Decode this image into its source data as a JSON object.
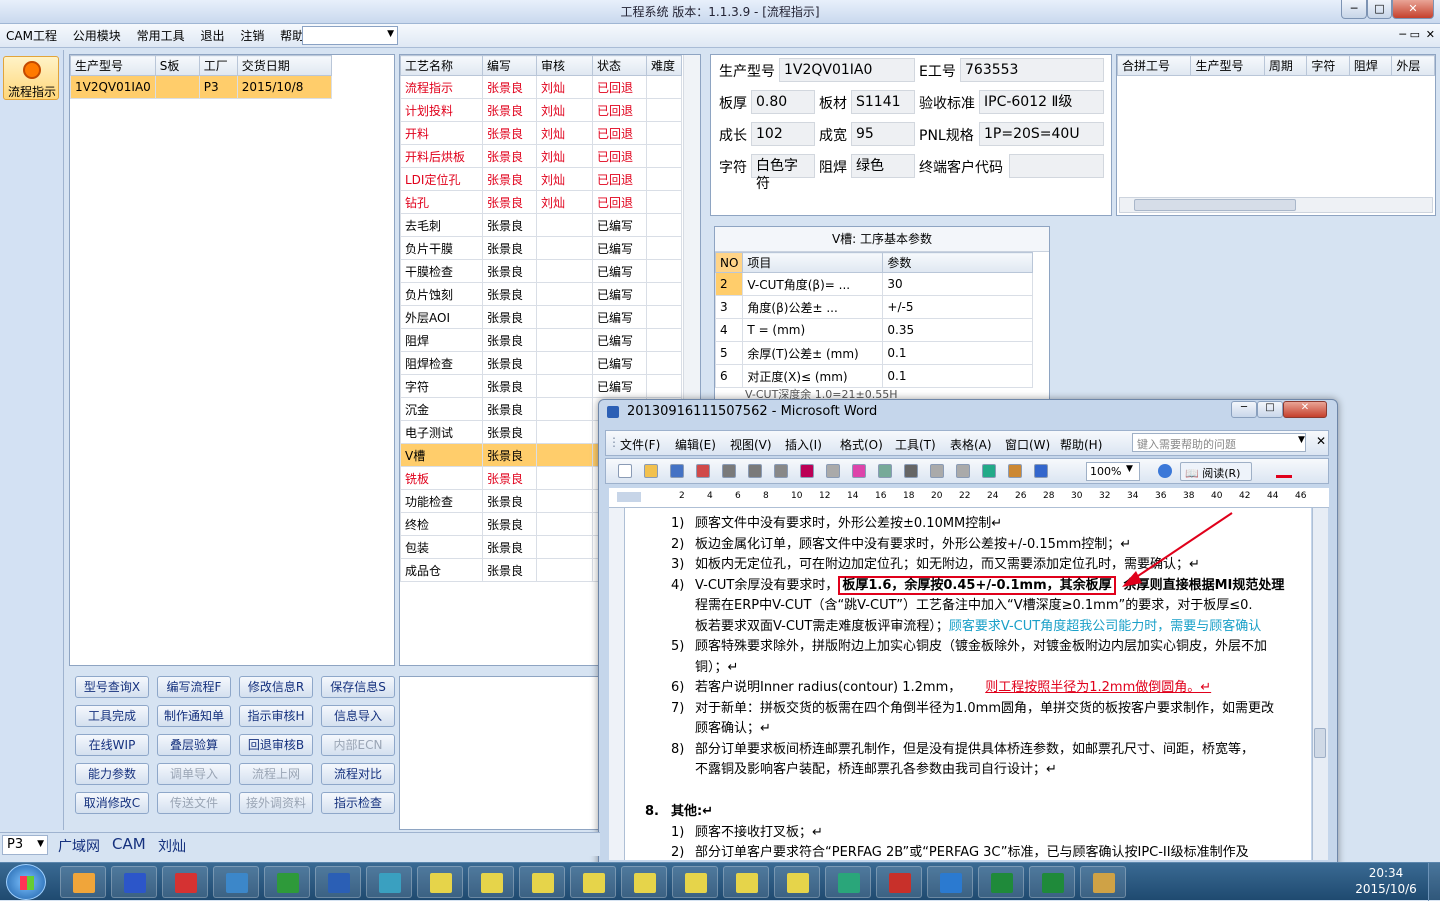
{
  "app": {
    "title": "工程系统   版本：1.1.3.9 - [流程指示]",
    "min": "─",
    "max": "□",
    "close": "✕",
    "inner_min": "─",
    "inner_restore": "▭",
    "inner_close": "✕"
  },
  "menu": {
    "items": [
      "CAM工程",
      "公用模块",
      "常用工具",
      "退出",
      "注销",
      "帮助"
    ],
    "help_arrow": "▾",
    "combo_value": ""
  },
  "nav": {
    "button_label": "流程指示",
    "icon": "flow-icon"
  },
  "orders": {
    "headers": [
      "生产型号",
      "S板",
      "工厂",
      "交货日期"
    ],
    "rows": [
      [
        "1V2QV01IA0",
        "",
        "P3",
        "2015/10/8"
      ]
    ]
  },
  "process": {
    "headers": [
      "工艺名称",
      "编写",
      "审核",
      "状态",
      "难度"
    ],
    "rows": [
      [
        "流程指示",
        "张景良",
        "刘灿",
        "已回退",
        ""
      ],
      [
        "计划投料",
        "张景良",
        "刘灿",
        "已回退",
        ""
      ],
      [
        "开料",
        "张景良",
        "刘灿",
        "已回退",
        ""
      ],
      [
        "开料后烘板",
        "张景良",
        "刘灿",
        "已回退",
        ""
      ],
      [
        "LDI定位孔",
        "张景良",
        "刘灿",
        "已回退",
        ""
      ],
      [
        "钻孔",
        "张景良",
        "刘灿",
        "已回退",
        ""
      ],
      [
        "去毛刺",
        "张景良",
        "",
        "已编写",
        ""
      ],
      [
        "负片干膜",
        "张景良",
        "",
        "已编写",
        ""
      ],
      [
        "干膜检查",
        "张景良",
        "",
        "已编写",
        ""
      ],
      [
        "负片蚀刻",
        "张景良",
        "",
        "已编写",
        ""
      ],
      [
        "外层AOI",
        "张景良",
        "",
        "已编写",
        ""
      ],
      [
        "阻焊",
        "张景良",
        "",
        "已编写",
        ""
      ],
      [
        "阻焊检查",
        "张景良",
        "",
        "已编写",
        ""
      ],
      [
        "字符",
        "张景良",
        "",
        "已编写",
        ""
      ],
      [
        "沉金",
        "张景良",
        "",
        "",
        ""
      ],
      [
        "电子测试",
        "张景良",
        "",
        "",
        ""
      ],
      [
        "V槽",
        "张景良",
        "",
        "",
        ""
      ],
      [
        "铣板",
        "张景良",
        "",
        "",
        ""
      ],
      [
        "功能检查",
        "张景良",
        "",
        "",
        ""
      ],
      [
        "终检",
        "张景良",
        "",
        "",
        ""
      ],
      [
        "包装",
        "张景良",
        "",
        "",
        ""
      ],
      [
        "成品仓",
        "张景良",
        "",
        "",
        ""
      ]
    ]
  },
  "buttons": [
    [
      "型号查询X",
      "编写流程F",
      "修改信息R",
      "保存信息S"
    ],
    [
      "工具完成",
      "制作通知单",
      "指示审核H",
      "信息导入"
    ],
    [
      "在线WIP",
      "叠层验算",
      "回退审核B",
      "内部ECN"
    ],
    [
      "能力参数",
      "调单导入",
      "流程上网",
      "流程对比"
    ],
    [
      "取消修改C",
      "传送文件",
      "接外调资料",
      "指示检查"
    ]
  ],
  "info": {
    "model_label": "生产型号",
    "model": "1V2QV01IA0",
    "e_label": "E工号",
    "e": "763553",
    "thick_label": "板厚",
    "thick": "0.80",
    "mat_label": "板材",
    "mat": "S1141",
    "std_label": "验收标准",
    "std": "IPC-6012 Ⅱ级",
    "len_label": "成长",
    "len": "102",
    "wid_label": "成宽",
    "wid": "95",
    "pnl_label": "PNL规格",
    "pnl": "1P=20S=40U",
    "char_label": "字符",
    "char": "白色字符",
    "mask_label": "阻焊",
    "mask": "绿色",
    "cust_label": "终端客户代码",
    "cust": ""
  },
  "merge": {
    "headers": [
      "合拼工号",
      "生产型号",
      "周期",
      "字符",
      "阻焊",
      "外层"
    ]
  },
  "vcut": {
    "title": "V槽: 工序基本参数",
    "headers": [
      "NO",
      "项目",
      "参数"
    ],
    "rows": [
      [
        "2",
        "V-CUT角度(β)=   ...",
        "30"
      ],
      [
        "3",
        "角度(β)公差±   ...",
        "+/-5"
      ],
      [
        "4",
        "T =  (mm)",
        "0.35"
      ],
      [
        "5",
        "余厚(T)公差±   (mm)",
        "0.1"
      ],
      [
        "6",
        "对正度(X)≤ (mm)",
        "0.1"
      ]
    ],
    "cut_row": "V-CUT深度余      1.0=21±0.55H"
  },
  "word": {
    "title": "20130916111507562 - Microsoft Word",
    "menus": [
      "文件(F)",
      "编辑(E)",
      "视图(V)",
      "插入(I)",
      "格式(O)",
      "工具(T)",
      "表格(A)",
      "窗口(W)",
      "帮助(H)"
    ],
    "help_placeholder": "键入需要帮助的问题",
    "zoom": "100%",
    "read_btn": "阅读(R)",
    "ruler": [
      "2",
      "4",
      "6",
      "8",
      "10",
      "12",
      "14",
      "16",
      "18",
      "20",
      "22",
      "24",
      "26",
      "28",
      "30",
      "32",
      "34",
      "36",
      "38",
      "40",
      "42",
      "44",
      "46"
    ],
    "lines": [
      {
        "n": "1)",
        "t": "顾客文件中没有要求时，外形公差按±0.10MM控制↵"
      },
      {
        "n": "2)",
        "t": "板边金属化订单，顾客文件中没有要求时，外形公差按+/-0.15mm控制；↵"
      },
      {
        "n": "3)",
        "t": "如板内无定位孔，可在附边加定位孔；如无附边，而又需要添加定位孔时，需要确认；↵"
      },
      {
        "n": "4)",
        "t": "V-CUT余厚没有要求时，",
        "bold": "板厚1.6，余厚按0.45+/-0.1mm，其余板厚",
        "t2": "余厚则直接根据MI规范处理"
      },
      {
        "n": "",
        "t": "程需在ERP中V-CUT（含“跳V-CUT”）工艺备注中加入“V槽深度≥0.1mm”的要求，对于板厚≤0."
      },
      {
        "n": "",
        "t": "板若要求双面V-CUT需走难度板评审流程）；",
        "blue": "顾客要求V-CUT角度超我公司能力时，需要与顾客确认"
      },
      {
        "n": "5)",
        "t": "顾客特殊要求除外，拼版附边上加实心铜皮（镀金板除外，对镀金板附边内层加实心铜皮，外层不加"
      },
      {
        "n": "",
        "t": "铜）；↵"
      },
      {
        "n": "6)",
        "t": "若客户说明Inner radius(contour) 1.2mm，",
        "red": "则工程按照半径为1.2mm做倒圆角。↵"
      },
      {
        "n": "7)",
        "t": "对于新单：拼板交货的板需在四个角倒半径为1.0mm圆角，单拼交货的板按客户要求制作，如需更改"
      },
      {
        "n": "",
        "t": "顾客确认；↵"
      },
      {
        "n": "8)",
        "t": "部分订单要求板间桥连邮票孔制作，但是没有提供具体桥连参数，如邮票孔尺寸、间距，桥宽等，"
      },
      {
        "n": "",
        "t": "不露铜及影响客户装配，桥连邮票孔各参数由我司自行设计；↵"
      }
    ],
    "section_num": "8.",
    "section": "其他:↵",
    "lines2": [
      {
        "n": "1)",
        "t": "顾客不接收打叉板；↵"
      },
      {
        "n": "2)",
        "t": "部分订单客户要求符合“PERFAG 2B”或“PERFAG 3C”标准，已与顾客确认按IPC-II级标准制作及"
      }
    ]
  },
  "status": {
    "factory": "P3",
    "net": "广域网",
    "dept": "CAM",
    "user": "刘灿"
  },
  "taskbar": {
    "time": "20:34",
    "date": "2015/10/6"
  },
  "colors": {
    "accent": "#ffcd6b",
    "red": "#e0001b",
    "blue": "#1aa0c8"
  }
}
